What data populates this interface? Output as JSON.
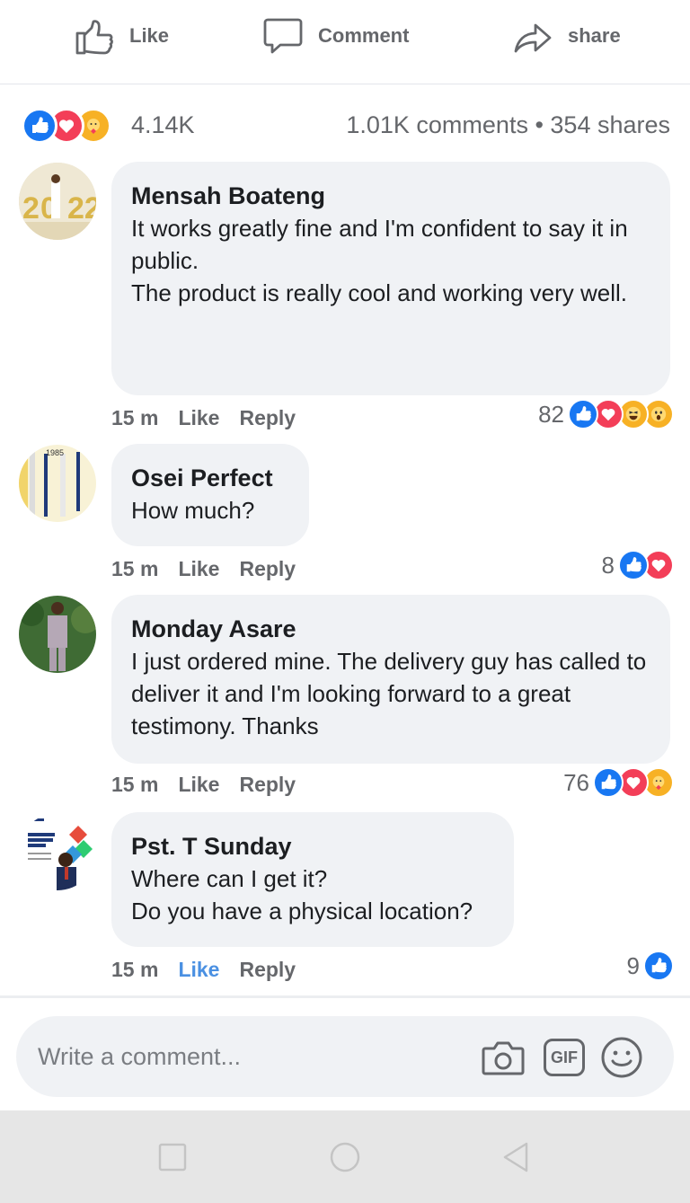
{
  "actions": {
    "like_label": "Like",
    "comment_label": "Comment",
    "share_label": "share"
  },
  "stats": {
    "reaction_count": "4.14K",
    "comments_shares": "1.01K comments • 354 shares",
    "reaction_icons": [
      "like-icon",
      "love-icon",
      "care-icon"
    ]
  },
  "comments": [
    {
      "author": "Mensah Boateng",
      "text": "It works greatly fine and I'm confident to say it in public.\nThe product is really cool and working very well.",
      "time": "15 m",
      "like_label": "Like",
      "reply_label": "Reply",
      "reactions": "82",
      "reaction_icons": [
        "like-icon",
        "love-icon",
        "haha-icon",
        "wow-icon"
      ]
    },
    {
      "author": "Osei Perfect",
      "text": "How much?",
      "time": "15 m",
      "like_label": "Like",
      "reply_label": "Reply",
      "reactions": "8",
      "reaction_icons": [
        "like-icon",
        "love-icon"
      ]
    },
    {
      "author": "Monday Asare",
      "text": "I just ordered mine. The delivery guy has called to deliver it and I'm looking forward to a great testimony. Thanks",
      "time": "15 m",
      "like_label": "Like",
      "reply_label": "Reply",
      "reactions": "76",
      "reaction_icons": [
        "like-icon",
        "love-icon",
        "care-icon"
      ]
    },
    {
      "author": "Pst. T Sunday",
      "text": "Where can I get it?\nDo you have a physical location?",
      "time": "15 m",
      "like_label": "Like",
      "reply_label": "Reply",
      "liked": true,
      "reactions": "9",
      "reaction_icons": [
        "like-icon"
      ]
    }
  ],
  "composer": {
    "placeholder": "Write a comment...",
    "gif_label": "GIF"
  },
  "colors": {
    "accent": "#1877f2",
    "liked": "#4a90e2",
    "muted_text": "#65676b",
    "bubble": "#f0f2f5"
  }
}
